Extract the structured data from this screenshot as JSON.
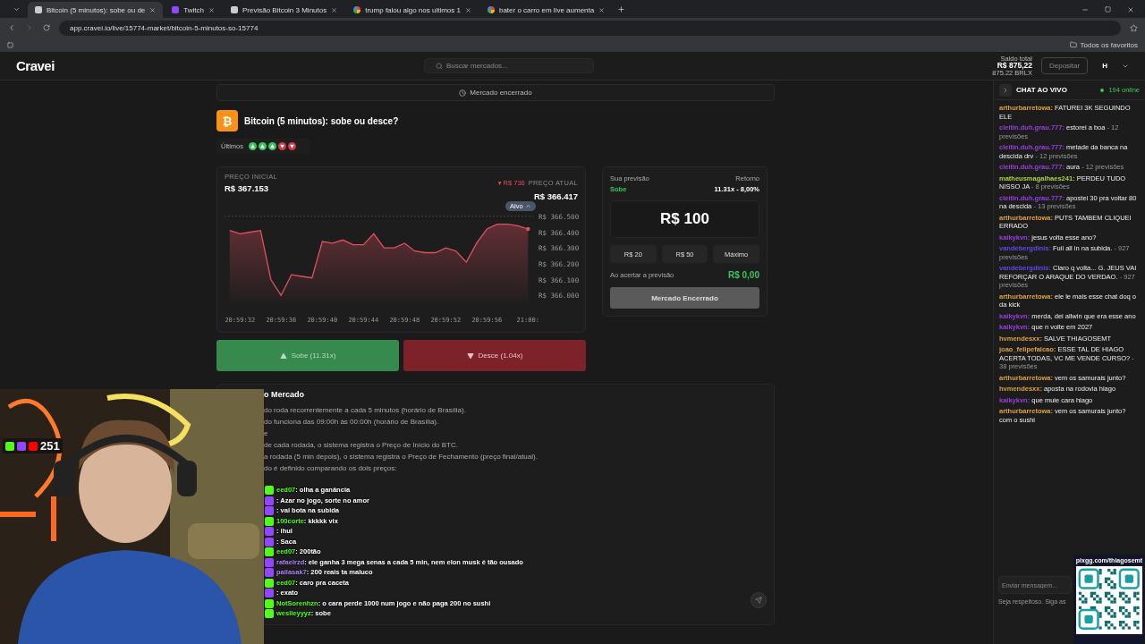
{
  "browser": {
    "tabs": [
      {
        "title": "Bitcoin (5 minutos): sobe ou de",
        "kind": "site",
        "selected": true
      },
      {
        "title": "Twitch",
        "kind": "twitch",
        "selected": false
      },
      {
        "title": "Previsão Bitcoin 3 Minutos",
        "kind": "site",
        "selected": false
      },
      {
        "title": "trump falou algo nos ultimos 1",
        "kind": "google",
        "selected": false
      },
      {
        "title": "bater o carro em live aumenta",
        "kind": "google",
        "selected": false
      }
    ],
    "url": "app.cravei.io/live/15774-market/bitcoin-5-minutos-so-15774",
    "bookmarks_folder": "Todos os favoritos"
  },
  "header": {
    "logo": "Cravei",
    "search_placeholder": "Buscar mercados...",
    "balance_label": "Saldo total",
    "balance": "R$ 875,22",
    "balance_sub": "875.22 BRLX",
    "deposit": "Depositar",
    "avatar": "H"
  },
  "market": {
    "status": "Mercado encerrado",
    "coin_symbol": "₿",
    "title": "Bitcoin (5 minutos): sobe ou desce?",
    "history_label": "Últimos",
    "history": [
      {
        "kind": "up"
      },
      {
        "kind": "up"
      },
      {
        "kind": "up"
      },
      {
        "kind": "down"
      },
      {
        "kind": "down"
      }
    ],
    "initial_label": "PREÇO INICIAL",
    "initial_price": "R$ 367.153",
    "delta": "▾ R$ 736",
    "current_label": "PREÇO ATUAL",
    "current_price": "R$ 366.417",
    "target_badge": "Alvo",
    "chart_y_labels": [
      "R$ 366.500",
      "R$ 366.400",
      "R$ 366.300",
      "R$ 366.200",
      "R$ 366.100",
      "R$ 366.000"
    ],
    "chart_x_labels": [
      "20:59:32",
      "20:59:36",
      "20:59:40",
      "20:59:44",
      "20:59:48",
      "20:59:52",
      "20:59:56",
      "21:00:"
    ],
    "up_button": "Sobe (11.31x)",
    "down_button": "Desce (1.04x)",
    "prediction_label": "Sua previsão",
    "prediction": "Sobe",
    "return_label": "Retorno",
    "return_value": "11.31x - 8,00%",
    "amount": "R$ 100",
    "amount_options": [
      "R$ 20",
      "R$ 50",
      "Máximo"
    ],
    "payout_label": "Ao acertar a previsão",
    "payout": "R$ 0,00",
    "closed_button": "Mercado Encerrado",
    "about_title": "o Mercado",
    "about_lines": [
      "do roda recorrentemente a cada 5 minutos (horário de Brasília).",
      "do funciona das 09:00h às 00:00h (horário de Brasília).",
      "e",
      "de cada rodada, o sistema registra o Preço de Início do BTC.",
      "a rodada (5 min depois), o sistema registra o Preço de Fechamento (preço final/atual).",
      "do é definido comparando os dois preços:"
    ]
  },
  "chat": {
    "title": "CHAT AO VIVO",
    "online": "194 online",
    "messages": [
      {
        "user": "arthurbarretowa:",
        "color": "#e0a040",
        "text": "FATUREI 3K SEGUINDO ELE"
      },
      {
        "user": "cleitin.duh.grau.777:",
        "color": "#9a3ee0",
        "text": "estorei a boa",
        "meta": "- 12 previsões"
      },
      {
        "user": "cleitin.duh.grau.777:",
        "color": "#9a3ee0",
        "text": "metade da banca na descida drv",
        "meta": "- 12 previsões"
      },
      {
        "user": "cleitin.duh.grau.777:",
        "color": "#9a3ee0",
        "text": "aura",
        "meta": "- 12 previsões"
      },
      {
        "user": "matheusmagalhaes241:",
        "color": "#a8d040",
        "text": "PERDEU TUDO NISSO JA",
        "meta": "- 8 previsões"
      },
      {
        "user": "cleitin.duh.grau.777:",
        "color": "#9a3ee0",
        "text": "apostei 30 pra voltar 80 na descida",
        "meta": "- 13 previsões"
      },
      {
        "user": "arthurbarretowa:",
        "color": "#e0a040",
        "text": "PUTS TAMBEM CLIQUEI ERRADO"
      },
      {
        "user": "kaikykvn:",
        "color": "#9a3ee0",
        "text": "jesus volta esse ano?"
      },
      {
        "user": "vandebergdinis:",
        "color": "#6048e0",
        "text": "Fuii all in na subida.",
        "meta": "- 927 previsões"
      },
      {
        "user": "vandebergdinis:",
        "color": "#6048e0",
        "text": "Claro q volta... G. JEUS VAI REFORÇAR O ARAQUE DO VERDAO.",
        "meta": "- 927 previsões"
      },
      {
        "user": "arthurbarretowa:",
        "color": "#e0a040",
        "text": "ele le mais esse chat doq o da kick"
      },
      {
        "user": "kaikykvn:",
        "color": "#9a3ee0",
        "text": "merda, dei allwin que era esse ano"
      },
      {
        "user": "kaikykvn:",
        "color": "#9a3ee0",
        "text": "que n volte em 2027"
      },
      {
        "user": "hvmendesxx:",
        "color": "#e0a040",
        "text": "SALVE THIAGOSEMT"
      },
      {
        "user": "joao_felipefalcao:",
        "color": "#e0a040",
        "text": "ESSE TAL DE HIAGO ACERTA TODAS, VC ME VENDE CURSO?",
        "meta": "- 38 previsões"
      },
      {
        "user": "arthurbarretowa:",
        "color": "#e0a040",
        "text": "vem os samurais junto?"
      },
      {
        "user": "hvmendesxx:",
        "color": "#e0a040",
        "text": "aposta na rodovia hiago"
      },
      {
        "user": "kaikykvn:",
        "color": "#9a3ee0",
        "text": "que muie cara hiago"
      },
      {
        "user": "arthurbarretowa:",
        "color": "#e0a040",
        "text": "vem os samurais junto? com o sushi"
      }
    ],
    "input_placeholder": "Enviar mensagem...",
    "rules": "Seja respeitoso. Siga as"
  },
  "stream": {
    "viewers": "251",
    "qr_caption": "pixgg.com/thiagosemt",
    "overlay_chat": [
      {
        "kind": "kick",
        "user": "eed07",
        "text": ": olha a ganância"
      },
      {
        "kind": "twitch",
        "text": ": Azar no jogo, sorte no amor"
      },
      {
        "kind": "twitch",
        "text": ": vai bota na subida"
      },
      {
        "kind": "kick",
        "user": "100corte",
        "text": ": kkkkk vix"
      },
      {
        "kind": "twitch",
        "text": ": ihul"
      },
      {
        "kind": "twitch",
        "text": ": Saca"
      },
      {
        "kind": "kick",
        "user": "eed07",
        "text": ": 200tão"
      },
      {
        "kind": "twitch",
        "user": "rafaelrzd",
        "text": ": ele ganha 3 mega senas a cada 5 min, nem elon musk é tão ousado"
      },
      {
        "kind": "twitch",
        "user": "pallasak7",
        "text": ": 200 reais ta maluco"
      },
      {
        "kind": "kick",
        "user": "eed07",
        "text": ": caro pra caceta"
      },
      {
        "kind": "twitch",
        "text": ": exato"
      },
      {
        "kind": "kick",
        "user": "NotSorenhzn",
        "text": ": o cara perde 1000 num jogo e não paga 200 no sushi"
      },
      {
        "kind": "kick",
        "user": "weslleyyyz",
        "text": ": sobe"
      }
    ]
  }
}
